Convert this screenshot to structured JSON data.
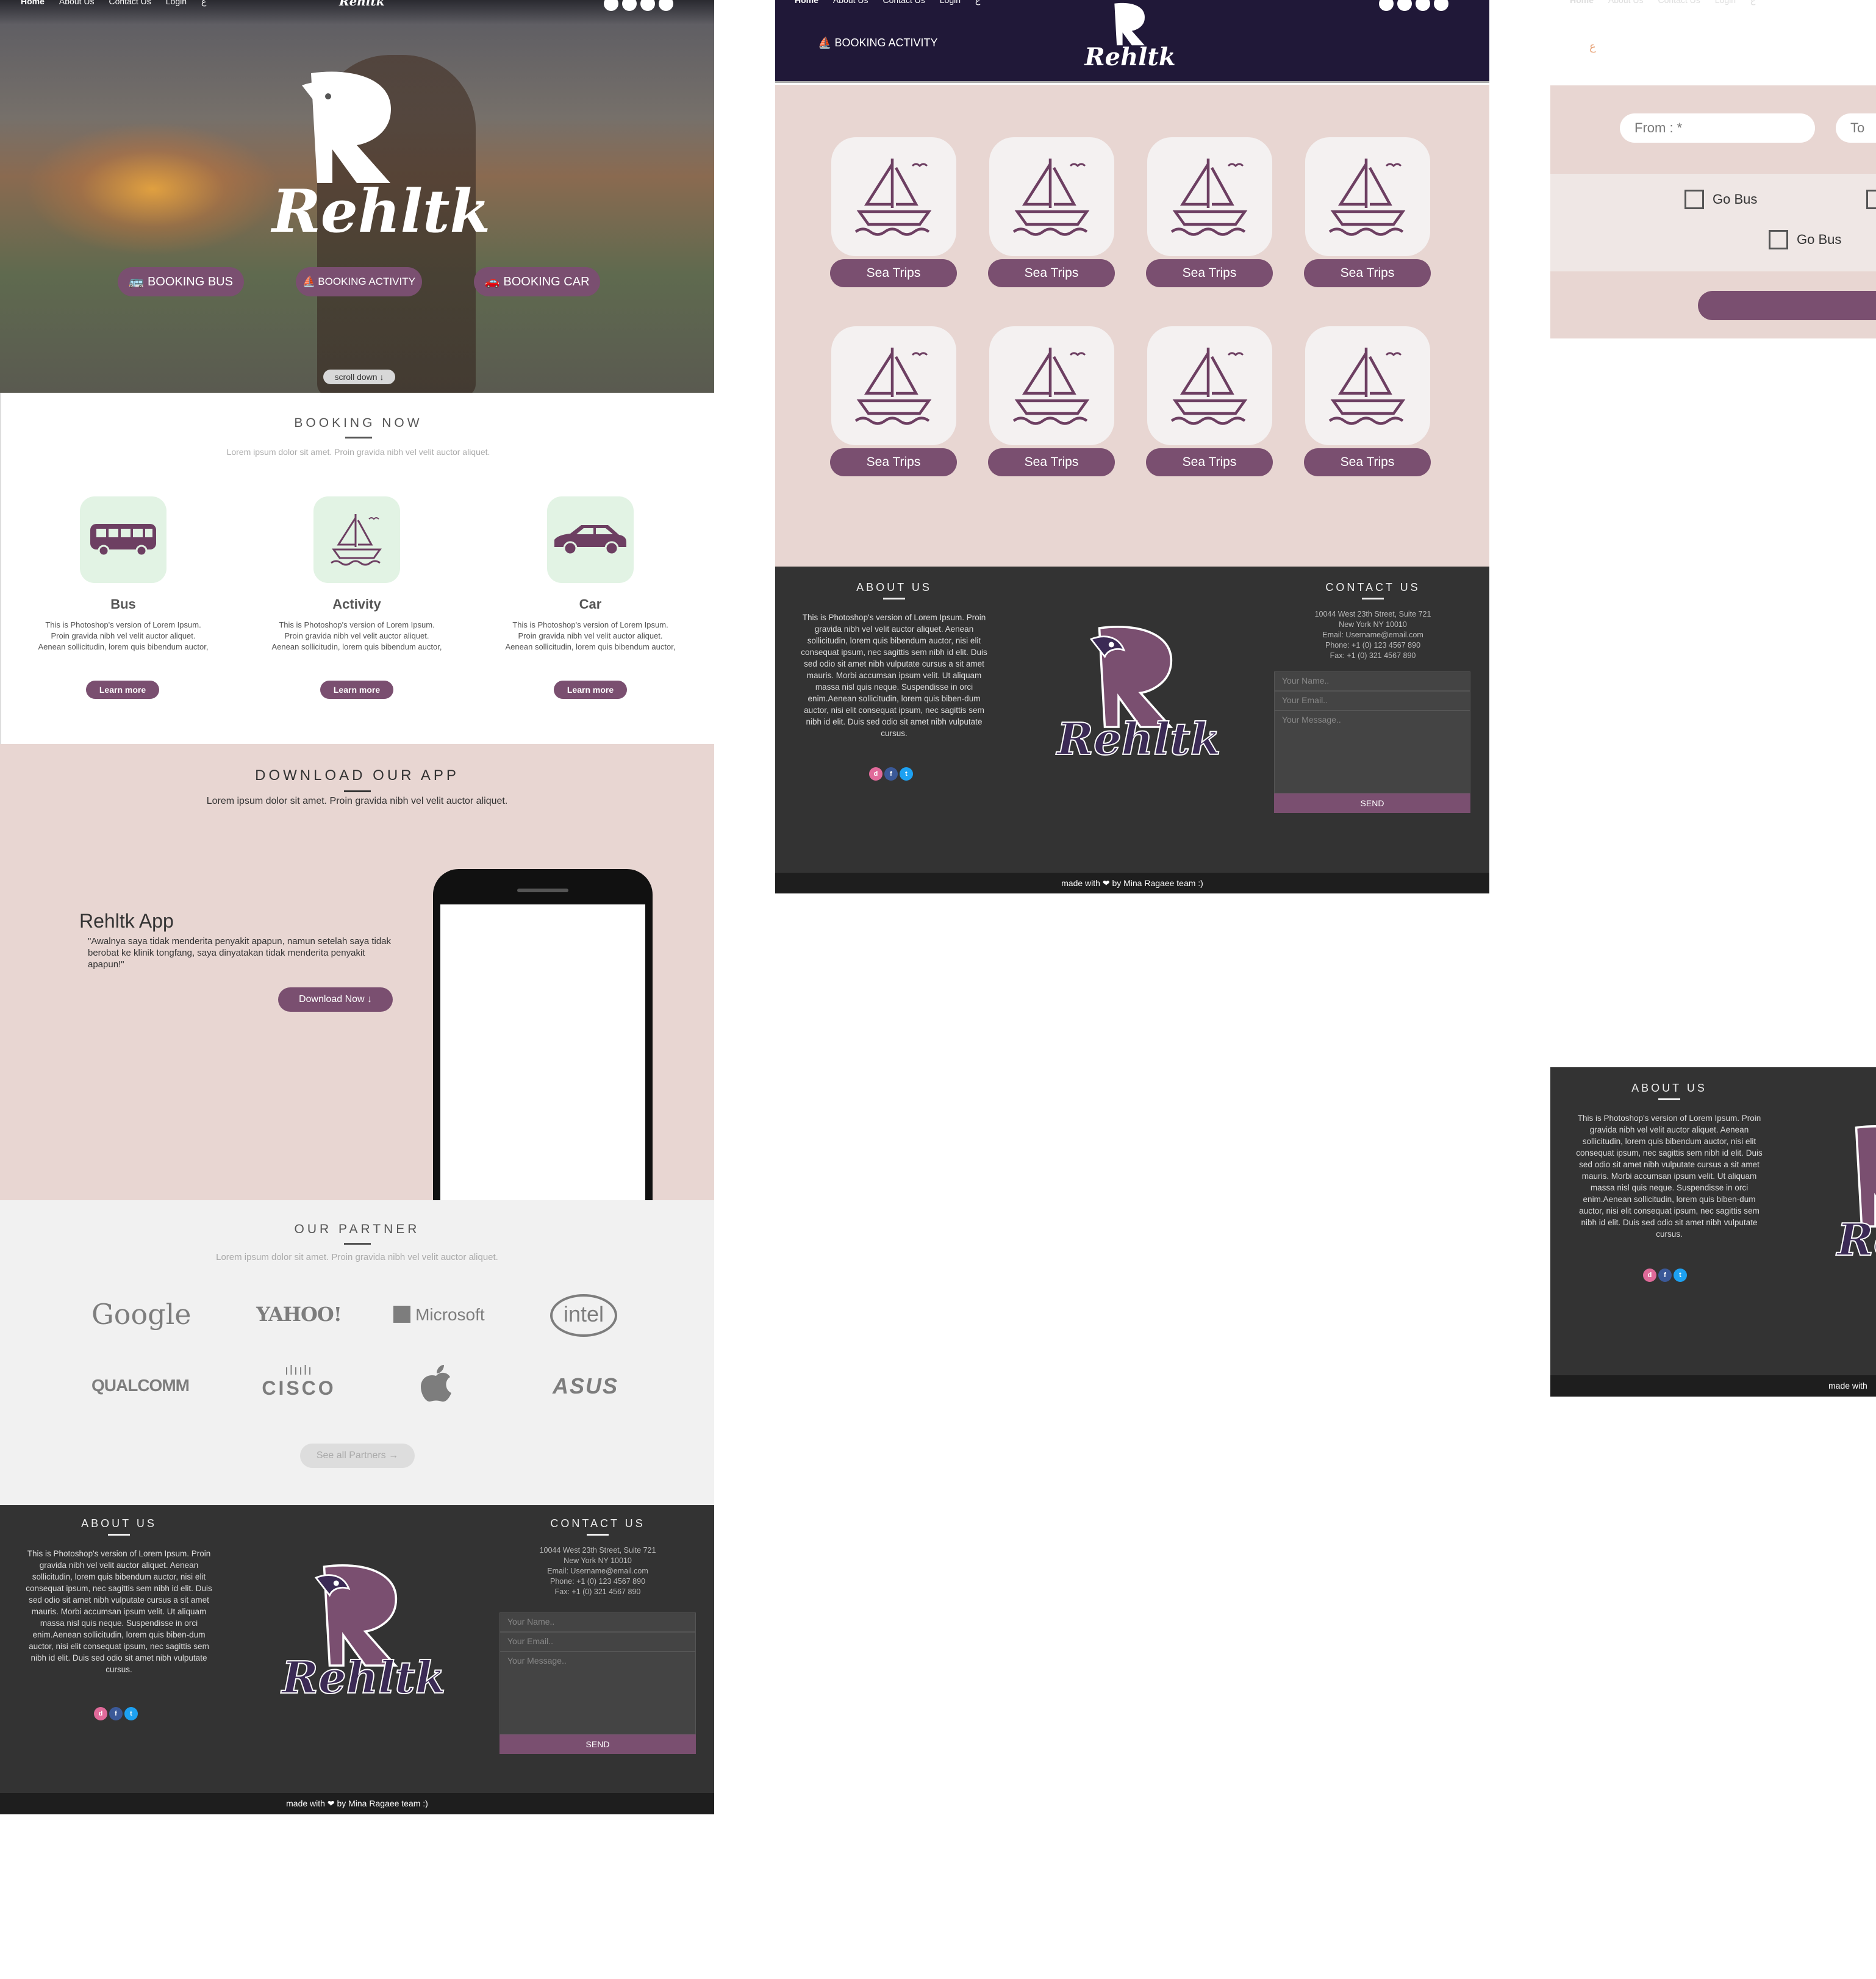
{
  "nav": {
    "home": "Home",
    "about": "About Us",
    "contact": "Contact Us",
    "login": "Login",
    "lang": "ع"
  },
  "brand": {
    "name": "Rehltk"
  },
  "hero": {
    "buttons": [
      "BOOKING BUS",
      "BOOKING ACTIVITY",
      "BOOKING CAR"
    ],
    "scroll_label": "scroll down"
  },
  "booking": {
    "title": "BOOKING NOW",
    "subtitle": "Lorem ipsum dolor sit amet. Proin gravida nibh vel velit auctor aliquet.",
    "items": [
      {
        "name": "Bus",
        "desc": "This is Photoshop's version  of Lorem Ipsum. Proin gravida nibh vel velit auctor aliquet. Aenean sollicitudin, lorem quis bibendum auctor,",
        "cta": "Learn more"
      },
      {
        "name": "Activity",
        "desc": "This is Photoshop's version  of Lorem Ipsum. Proin gravida nibh vel velit auctor aliquet. Aenean sollicitudin, lorem quis bibendum auctor,",
        "cta": "Learn more"
      },
      {
        "name": "Car",
        "desc": "This is Photoshop's version  of Lorem Ipsum. Proin gravida nibh vel velit auctor aliquet. Aenean sollicitudin, lorem quis bibendum auctor,",
        "cta": "Learn more"
      }
    ]
  },
  "app": {
    "title": "DOWNLOAD OUR APP",
    "subtitle": "Lorem ipsum dolor sit amet. Proin gravida nibh vel velit auctor aliquet.",
    "name": "Rehltk App",
    "quote": "\"Awalnya saya tidak menderita penyakit apapun, namun setelah saya tidak berobat ke klinik tongfang, saya dinyatakan tidak menderita penyakit apapun!\"",
    "cta": "Download Now"
  },
  "partners": {
    "title": "OUR PARTNER",
    "subtitle": "Lorem ipsum dolor sit amet. Proin gravida nibh vel velit auctor aliquet.",
    "logos": [
      "Google",
      "YAHOO!",
      "Microsoft",
      "intel",
      "QUALCOMM",
      "CISCO",
      "",
      "ASUS"
    ],
    "cta": "See all Partners"
  },
  "footer": {
    "about_title": "ABOUT US",
    "about_text": "This is Photoshop's version  of Lorem Ipsum. Proin gravida nibh vel velit auctor aliquet. Aenean sollicitudin, lorem quis bibendum auctor, nisi elit consequat ipsum, nec sagittis sem nibh id elit. Duis sed odio sit amet nibh vulputate cursus a sit amet mauris. Morbi accumsan ipsum velit. Ut aliquam massa nisl quis neque. Suspendisse in orci enim.Aenean sollicitudin, lorem quis biben-dum auctor, nisi elit consequat ipsum, nec sagittis sem nibh id elit. Duis sed odio sit amet nibh vulputate cursus.",
    "contact_title": "CONTACT US",
    "address1": "10044 West 23th Street, Suite 721",
    "address2": "New York NY 10010",
    "email": "Email: Username@email.com",
    "phone": "Phone: +1 (0) 123 4567 890",
    "fax": "Fax: +1 (0) 321 4567 890",
    "name_ph": "Your Name..",
    "email_ph": "Your Email..",
    "message_ph": "Your Message..",
    "send": "SEND",
    "credit": "made with ❤ by Mina Ragaee team :)",
    "credit_partial": "made with ❤"
  },
  "activity_page": {
    "header_label": "BOOKING ACTIVITY",
    "card_label": "Sea Trips"
  },
  "bus_page": {
    "from_ph": "From : *",
    "to_ph": "To",
    "option1": "Go Bus",
    "option2": "Go Bus",
    "header_text": "ع"
  },
  "colors": {
    "accent": "#7a4f70",
    "pink_bg": "#e8d6d2",
    "dark": "#333333",
    "navy": "#201838",
    "mint": "#e2f3e4"
  }
}
